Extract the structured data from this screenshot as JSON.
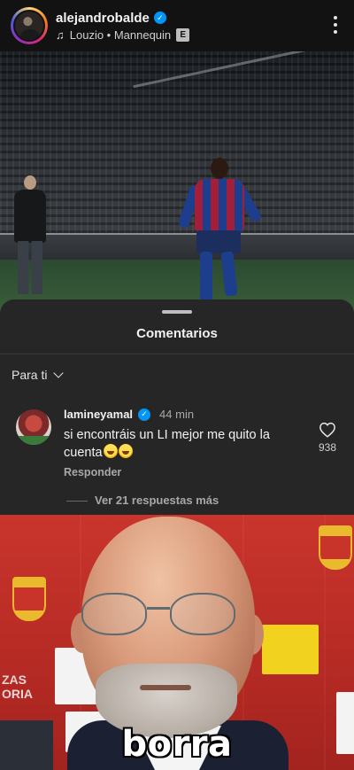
{
  "post": {
    "username": "alejandrobalde",
    "verified": true,
    "audio": "Louzio • Mannequin",
    "explicit_badge": "E",
    "menu_icon": "more-vertical-icon"
  },
  "comments_sheet": {
    "title": "Comentarios",
    "filter_label": "Para ti",
    "comment": {
      "username": "lamineyamal",
      "verified": true,
      "time": "44 min",
      "text": "si encontráis un LI mejor me quito la cuenta",
      "emojis": [
        "grinning-sweat-emoji",
        "grinning-sweat-emoji"
      ],
      "reply_label": "Responder",
      "like_count": "938"
    },
    "view_more": "Ver 21 respuestas más"
  },
  "meme": {
    "caption": "borra",
    "board_text": "ZAS\nORIA"
  },
  "colors": {
    "sheet_bg": "#262626",
    "header_bg": "#121212",
    "verified_blue": "#0095f6",
    "meme_red": "#c9352c"
  }
}
